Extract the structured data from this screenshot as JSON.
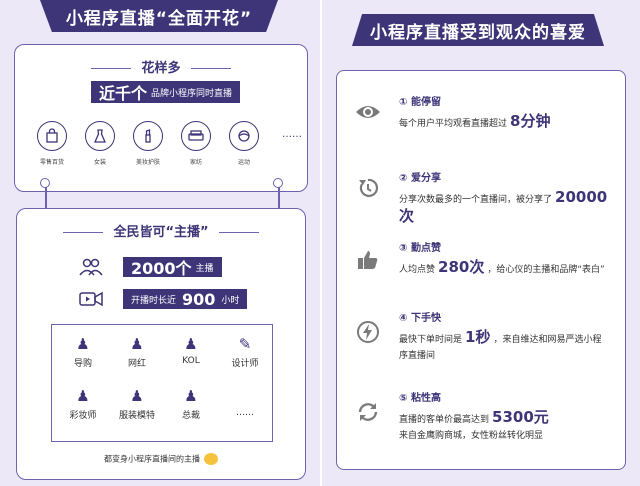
{
  "left": {
    "banner": "小程序直播“全面开花”",
    "card1": {
      "title": "花样多",
      "highlight_big": "近千个",
      "highlight_text": "品牌小程序同时直播",
      "categories": [
        {
          "icon": "shopping-bag-icon",
          "label": "零售百货"
        },
        {
          "icon": "dress-icon",
          "label": "女装"
        },
        {
          "icon": "lipstick-icon",
          "label": "美妆护肤"
        },
        {
          "icon": "sofa-icon",
          "label": "家纺"
        },
        {
          "icon": "sport-icon",
          "label": "运动"
        }
      ],
      "more": "……"
    },
    "card2": {
      "title": "全民皆可“主播”",
      "stat1_big": "2000个",
      "stat1_text": "主播",
      "stat2_pre": "开播时长近",
      "stat2_big": "900",
      "stat2_text": "小时",
      "roles": [
        {
          "icon": "guide-icon",
          "label": "导购"
        },
        {
          "icon": "influencer-icon",
          "label": "网红"
        },
        {
          "icon": "kol-icon",
          "label": "KOL"
        },
        {
          "icon": "designer-icon",
          "label": "设计师"
        },
        {
          "icon": "makeup-artist-icon",
          "label": "彩妆师"
        },
        {
          "icon": "model-icon",
          "label": "服装模特"
        },
        {
          "icon": "ceo-icon",
          "label": "总裁"
        }
      ],
      "more": "……",
      "footer": "都变身小程序直播间的主播"
    }
  },
  "right": {
    "banner": "小程序直播受到观众的喜爱",
    "features": [
      {
        "icon": "eye-icon",
        "title": "① 能停留",
        "desc_pre": "每个用户平均观看直播超过",
        "num": "8分钟",
        "desc_post": ""
      },
      {
        "icon": "share-icon",
        "title": "② 爱分享",
        "desc_pre": "分享次数最多的一个直播间，被分享了",
        "num": "20000次",
        "desc_post": ""
      },
      {
        "icon": "thumbs-up-icon",
        "title": "③ 勤点赞",
        "desc_pre": "人均点赞",
        "num": "280次",
        "desc_post": "，给心仪的主播和品牌“表白”"
      },
      {
        "icon": "lightning-icon",
        "title": "④ 下手快",
        "desc_pre": "最快下单时间是",
        "num": "1秒",
        "desc_post": "，来自维达和网易严选小程序直播间"
      },
      {
        "icon": "refresh-icon",
        "title": "⑤ 粘性高",
        "desc_pre": "直播的客单价最高达到",
        "num": "5300元",
        "desc_post": "来自金鹰购商城，女性粉丝转化明显"
      }
    ]
  }
}
